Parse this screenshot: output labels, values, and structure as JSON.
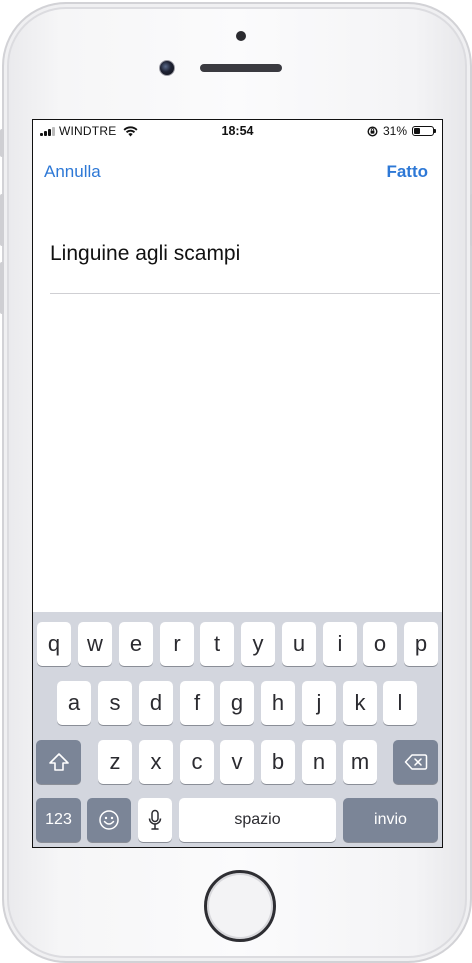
{
  "status_bar": {
    "carrier": "WINDTRE",
    "time": "18:54",
    "battery_percent": "31%",
    "battery_level": 0.31
  },
  "nav": {
    "cancel_label": "Annulla",
    "done_label": "Fatto"
  },
  "text_field": {
    "value": "Linguine agli scampi"
  },
  "keyboard": {
    "row1": [
      "q",
      "w",
      "e",
      "r",
      "t",
      "y",
      "u",
      "i",
      "o",
      "p"
    ],
    "row2": [
      "a",
      "s",
      "d",
      "f",
      "g",
      "h",
      "j",
      "k",
      "l"
    ],
    "row3": [
      "z",
      "x",
      "c",
      "v",
      "b",
      "n",
      "m"
    ],
    "numbers_label": "123",
    "space_label": "spazio",
    "return_label": "invio",
    "icons": {
      "shift": "shift-arrow",
      "backspace": "delete-backward",
      "emoji": "smiley-face",
      "dictation": "microphone"
    }
  },
  "colors": {
    "accent": "#2d78d6",
    "keyboard_bg": "#d3d6de",
    "dark_key": "#7b8597"
  }
}
